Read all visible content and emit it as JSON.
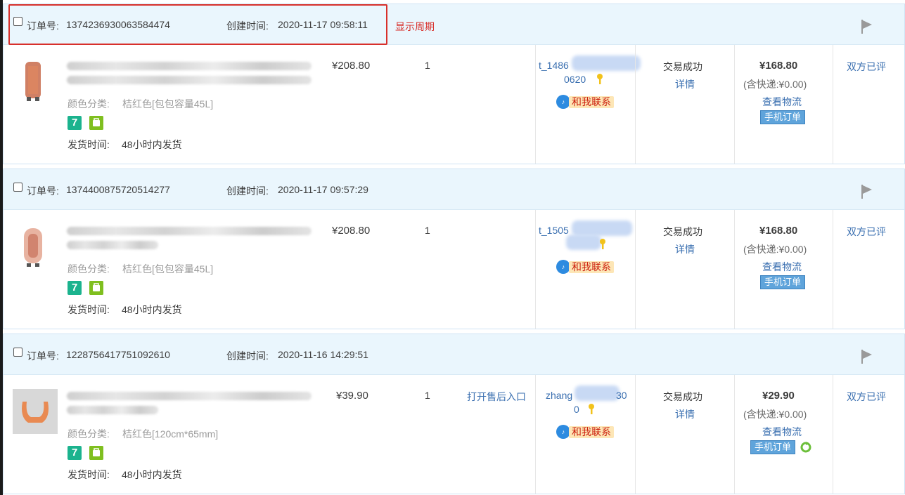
{
  "common": {
    "order_no_label": "订单号:",
    "created_label": "创建时间:",
    "sku_label": "颜色分类:",
    "ship_label": "发货时间:",
    "ship_value": "48小时内发货",
    "status": "交易成功",
    "detail": "详情",
    "shipping": "(含快递:¥0.00)",
    "logistics": "查看物流",
    "mobile_badge": "手机订单",
    "contact": "和我联系",
    "review": "双方已评",
    "svc_seven": "7"
  },
  "annotation": "显示周期",
  "orders": [
    {
      "order_no": "1374236930063584474",
      "created": "2020-11-17 09:58:11",
      "price": "¥208.80",
      "qty": "1",
      "sku": "桔红色[包包容量45L]",
      "buyer_prefix": "t_1486",
      "buyer_suffix": "0620",
      "amount": "¥168.80"
    },
    {
      "order_no": "1374400875720514277",
      "created": "2020-11-17 09:57:29",
      "price": "¥208.80",
      "qty": "1",
      "sku": "桔红色[包包容量45L]",
      "buyer_prefix": "t_1505",
      "buyer_suffix": "",
      "amount": "¥168.80"
    },
    {
      "order_no": "1228756417751092610",
      "created": "2020-11-16 14:29:51",
      "price": "¥39.90",
      "qty": "1",
      "sku": "桔红色[120cm*65mm]",
      "buyer_prefix": "zhang",
      "buyer_tail": "30",
      "buyer_suffix": "0",
      "amount": "¥29.90",
      "after_sale": "打开售后入口"
    }
  ]
}
